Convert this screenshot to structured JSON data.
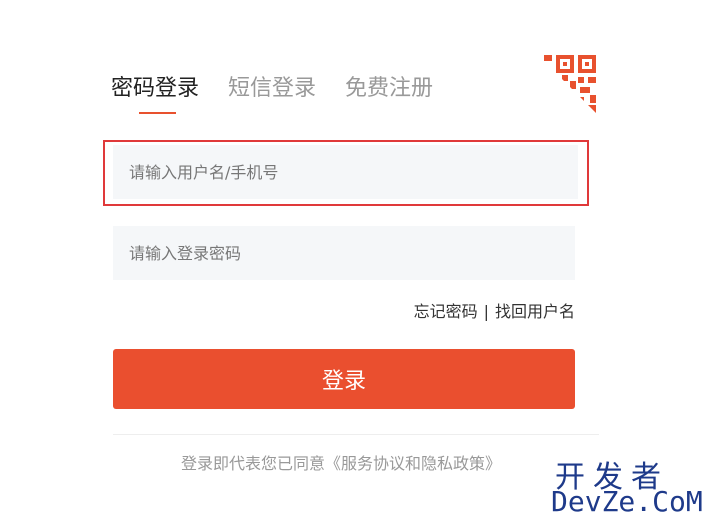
{
  "tabs": [
    {
      "label": "密码登录",
      "active": true
    },
    {
      "label": "短信登录",
      "active": false
    },
    {
      "label": "免费注册",
      "active": false
    }
  ],
  "accent_color": "#e8512e",
  "username": {
    "placeholder": "请输入用户名/手机号",
    "value": ""
  },
  "password": {
    "placeholder": "请输入登录密码",
    "value": ""
  },
  "links": {
    "forgot_password": "忘记密码",
    "separator": "|",
    "find_username": "找回用户名"
  },
  "login_button": "登录",
  "agreement": "登录即代表您已同意《服务协议和隐私政策》",
  "watermark": {
    "cn": "开发者",
    "en": "DevZe.CoM"
  }
}
